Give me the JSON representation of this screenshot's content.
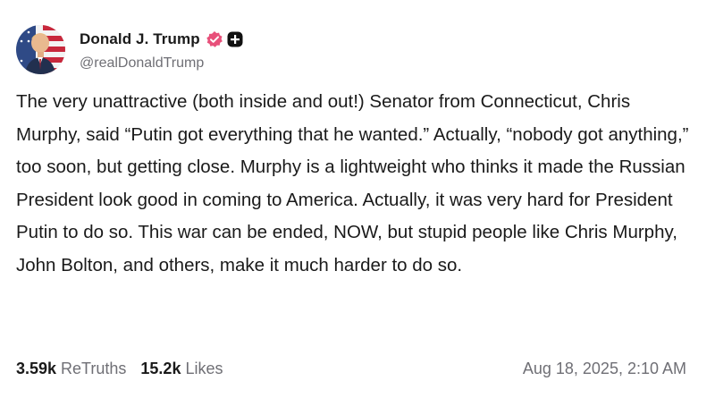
{
  "author": {
    "display_name": "Donald J. Trump",
    "handle": "@realDonaldTrump",
    "verified_icon": "verified-badge-icon",
    "plus_icon": "plus-badge-icon",
    "avatar_icon": "avatar"
  },
  "post": {
    "text": "The very unattractive (both inside and out!) Senator from Connecticut, Chris Murphy, said “Putin got everything that he wanted.” Actually, “nobody got anything,” too soon, but getting close. Murphy is a lightweight who thinks it made the Russian President look good in coming to America. Actually, it was very hard for President Putin to do so. This war can be ended, NOW, but stupid people like Chris Murphy, John Bolton, and others, make it much harder to do so."
  },
  "stats": {
    "retruths_count": "3.59k",
    "retruths_label": "ReTruths",
    "likes_count": "15.2k",
    "likes_label": "Likes"
  },
  "timestamp": "Aug 18, 2025, 2:10 AM",
  "colors": {
    "verified": "#e8507a",
    "text": "#1a1a1a",
    "muted": "#6f6f75"
  }
}
